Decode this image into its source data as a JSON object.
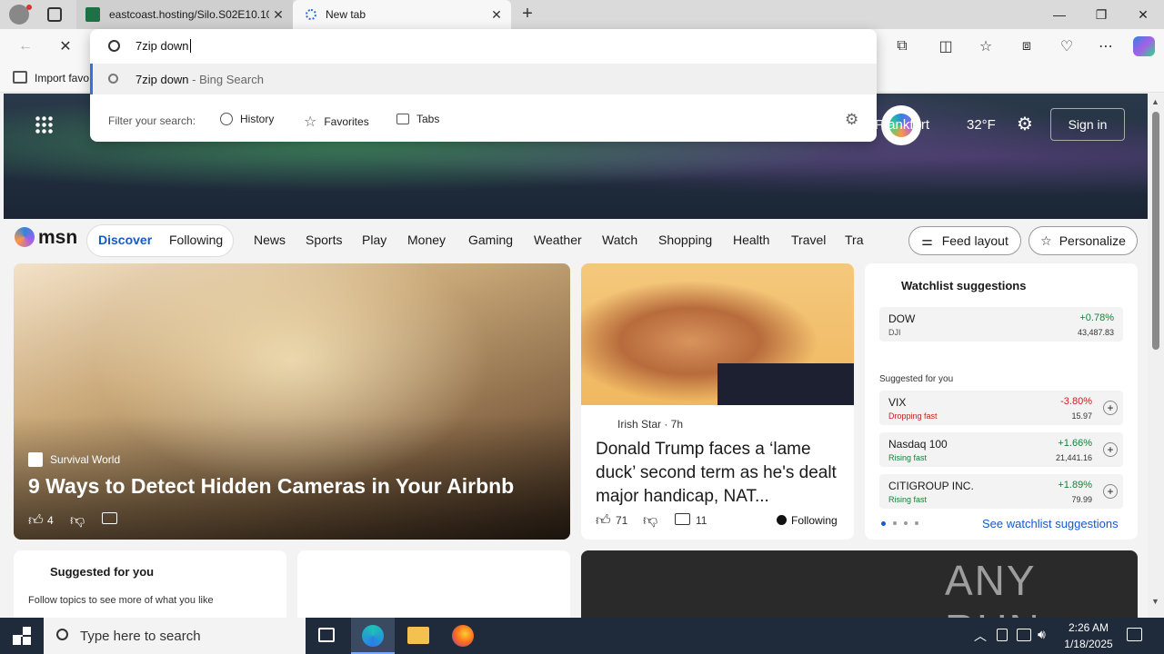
{
  "tabs": [
    {
      "label": "eastcoast.hosting/Silo.S02E10.10("
    },
    {
      "label": "New tab"
    }
  ],
  "omnibox": {
    "value": "7zip down",
    "suggestion_main": "7zip down",
    "suggestion_suffix": " - Bing Search",
    "filter_label": "Filter your search:",
    "filters": [
      "History",
      "Favorites",
      "Tabs"
    ]
  },
  "favorites_bar": {
    "import_label": "Import favo"
  },
  "msn_header": {
    "location": "Frankfurt",
    "temperature": "32°F",
    "sign_in": "Sign in"
  },
  "msn_nav": {
    "brand": "msn",
    "discover": "Discover",
    "following": "Following",
    "items": [
      "News",
      "Sports",
      "Play",
      "Money",
      "Gaming",
      "Weather",
      "Watch",
      "Shopping",
      "Health",
      "Travel",
      "Tra"
    ],
    "feed_layout": "Feed layout",
    "personalize": "Personalize"
  },
  "main_card": {
    "source": "Survival World",
    "headline": "9 Ways to Detect Hidden Cameras in Your Airbnb",
    "likes": "4"
  },
  "second_card": {
    "source": "Irish Star · 7h",
    "headline": "Donald Trump faces a ‘lame duck’ second term as he's dealt major handicap, NAT...",
    "likes": "71",
    "comments": "11",
    "following": "Following"
  },
  "watchlist": {
    "title": "Watchlist suggestions",
    "main": {
      "name": "DOW",
      "sub": "DJI",
      "change": "+0.78%",
      "value": "43,487.83"
    },
    "suggested_label": "Suggested for you",
    "items": [
      {
        "name": "VIX",
        "status": "Dropping fast",
        "change": "-3.80%",
        "value": "15.97"
      },
      {
        "name": "Nasdaq 100",
        "status": "Rising fast",
        "change": "+1.66%",
        "value": "21,441.16"
      },
      {
        "name": "CITIGROUP INC.",
        "status": "Rising fast",
        "change": "+1.89%",
        "value": "79.99"
      }
    ],
    "see_more": "See watchlist suggestions"
  },
  "suggested_card": {
    "title": "Suggested for you",
    "subtitle": "Follow topics to see more of what you like"
  },
  "watermark": "ANY RUN",
  "taskbar": {
    "search_placeholder": "Type here to search",
    "time": "2:26 AM",
    "date": "1/18/2025"
  }
}
